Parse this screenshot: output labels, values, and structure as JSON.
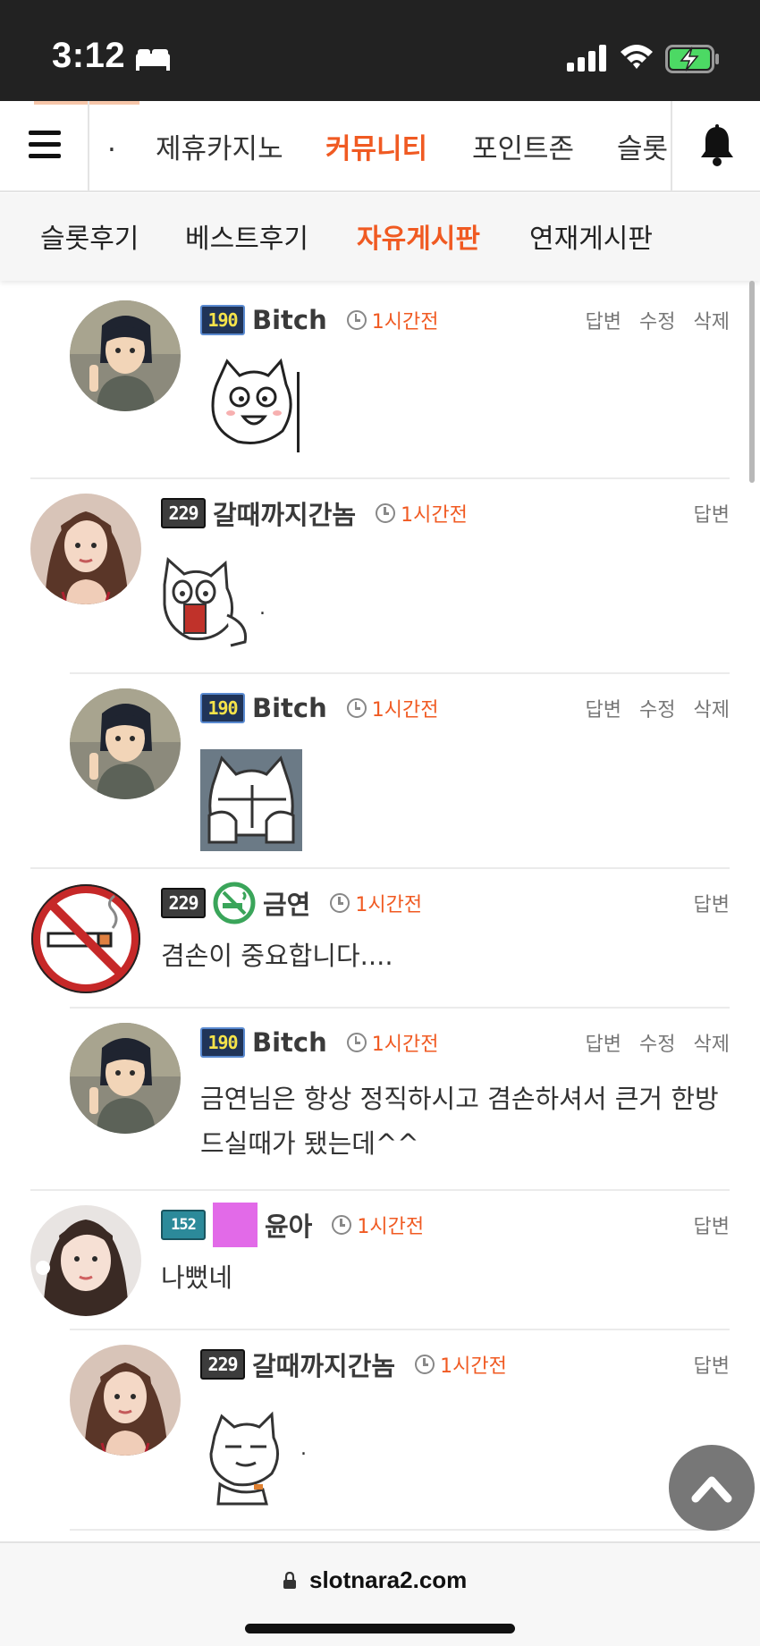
{
  "status_bar": {
    "time": "3:12"
  },
  "top_nav": {
    "items": [
      {
        "label": "."
      },
      {
        "label": "제휴카지노"
      },
      {
        "label": "커뮤니티",
        "active": true
      },
      {
        "label": "포인트존"
      },
      {
        "label": "슬롯"
      }
    ]
  },
  "sub_nav": {
    "items": [
      {
        "label": "슬롯후기"
      },
      {
        "label": "베스트후기"
      },
      {
        "label": "자유게시판",
        "active": true
      },
      {
        "label": "연재게시판"
      }
    ]
  },
  "comments": [
    {
      "level": "190",
      "nick": "Bitch",
      "time": "1시간전",
      "actions": [
        "답변",
        "수정",
        "삭제"
      ],
      "reply": true,
      "content_type": "sticker",
      "sticker": "cat-laughing-sticker"
    },
    {
      "level": "229",
      "nick": "갈때까지간놈",
      "time": "1시간전",
      "actions": [
        "답변"
      ],
      "reply": false,
      "content_type": "sticker",
      "sticker": "cat-holding-card-sticker",
      "trailing": "."
    },
    {
      "level": "190",
      "nick": "Bitch",
      "time": "1시간전",
      "actions": [
        "답변",
        "수정",
        "삭제"
      ],
      "reply": true,
      "content_type": "sticker",
      "sticker": "cat-hiding-sticker"
    },
    {
      "level": "229",
      "nick": "금연",
      "time": "1시간전",
      "actions": [
        "답변"
      ],
      "reply": false,
      "content_type": "text",
      "text": "겸손이 중요합니다...."
    },
    {
      "level": "190",
      "nick": "Bitch",
      "time": "1시간전",
      "actions": [
        "답변",
        "수정",
        "삭제"
      ],
      "reply": true,
      "content_type": "text",
      "text_lines": [
        "금연님은 항상 정직하시고 겸손하셔서 큰거 한방",
        "드실때가 됐는데^^"
      ]
    },
    {
      "level": "152",
      "nick": "윤아",
      "time": "1시간전",
      "actions": [
        "답변"
      ],
      "reply": false,
      "content_type": "text",
      "text": "나뻤네"
    },
    {
      "level": "229",
      "nick": "갈때까지간놈",
      "time": "1시간전",
      "actions": [
        "답변"
      ],
      "reply": true,
      "content_type": "sticker",
      "sticker": "cat-smug-sticker",
      "trailing": "."
    }
  ],
  "url_bar": {
    "url": "slotnara2.com"
  },
  "colors": {
    "accent": "#f05a22",
    "status_bar": "#222222",
    "subnav_bg": "#f6f6f6"
  }
}
